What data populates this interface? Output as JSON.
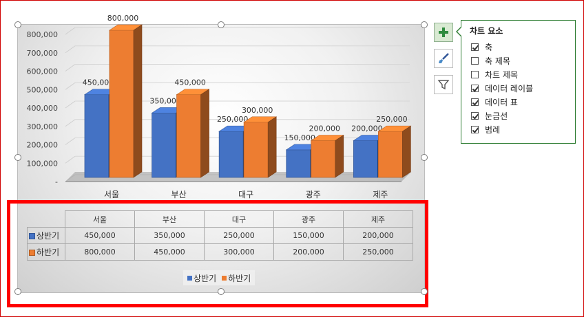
{
  "chart_data": {
    "type": "bar",
    "categories": [
      "서울",
      "부산",
      "대구",
      "광주",
      "제주"
    ],
    "series": [
      {
        "name": "상반기",
        "values": [
          450000,
          350000,
          250000,
          150000,
          200000
        ],
        "color": "#4472c4"
      },
      {
        "name": "하반기",
        "values": [
          800000,
          450000,
          300000,
          200000,
          250000
        ],
        "color": "#ed7d31"
      }
    ],
    "y_ticks": [
      "-",
      "100,000",
      "200,000",
      "300,000",
      "400,000",
      "500,000",
      "600,000",
      "700,000",
      "800,000"
    ],
    "data_labels": [
      [
        "450,000",
        "350,000",
        "250,000",
        "150,000",
        "200,000"
      ],
      [
        "800,000",
        "450,000",
        "300,000",
        "200,000",
        "250,000"
      ]
    ],
    "ylim": [
      0,
      800000
    ],
    "grid": true,
    "style": "3d-clustered-column",
    "legend_position": "bottom",
    "data_table": {
      "headers": [
        "서울",
        "부산",
        "대구",
        "광주",
        "제주"
      ],
      "rows": [
        {
          "label": "상반기",
          "values": [
            "450,000",
            "350,000",
            "250,000",
            "150,000",
            "200,000"
          ]
        },
        {
          "label": "하반기",
          "values": [
            "800,000",
            "450,000",
            "300,000",
            "200,000",
            "250,000"
          ]
        }
      ]
    },
    "legend": [
      "상반기",
      "하반기"
    ]
  },
  "side_buttons": {
    "add": {
      "icon": "plus-icon"
    },
    "style": {
      "icon": "brush-icon"
    },
    "filter": {
      "icon": "filter-icon"
    }
  },
  "chart_elements_panel": {
    "title": "차트 요소",
    "options": [
      {
        "label": "축",
        "checked": true
      },
      {
        "label": "축 제목",
        "checked": false
      },
      {
        "label": "차트 제목",
        "checked": false
      },
      {
        "label": "데이터 레이블",
        "checked": true
      },
      {
        "label": "데이터 표",
        "checked": true
      },
      {
        "label": "눈금선",
        "checked": true
      },
      {
        "label": "범례",
        "checked": true
      }
    ]
  },
  "colors": {
    "series1": "#4472c4",
    "series2": "#ed7d31",
    "highlight": "#ff0000",
    "panel_border": "#2e7d32"
  }
}
